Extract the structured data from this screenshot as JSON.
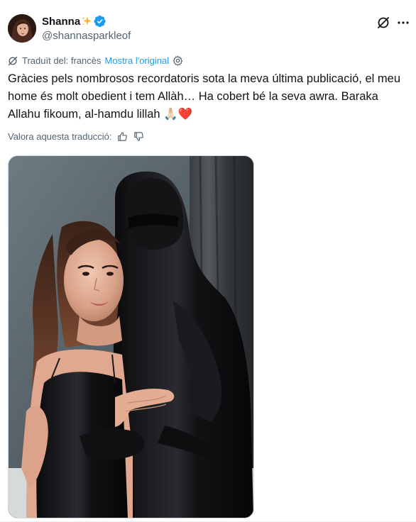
{
  "author": {
    "display_name": "Shanna",
    "handle": "@shannasparkleof",
    "name_emoji_icon": "sparkle-icon",
    "verified_icon": "verified-badge-icon",
    "verified_color": "#1d9bf0"
  },
  "translation": {
    "label": "Traduït del: francès",
    "show_original": "Mostra l'original"
  },
  "post": {
    "text": "Gràcies pels nombrosos recordatoris sota la meva última publicació, el meu home és molt obedient i tem Allàh… Ha cobert bé la seva awra. Baraka Allahu fikoum, al-hamdu lillah 🙏🏻❤️"
  },
  "rating": {
    "label": "Valora aquesta traducció:"
  },
  "colors": {
    "text": "#0f1419",
    "muted": "#536471",
    "link": "#1d9bf0",
    "border": "#cfd9de"
  }
}
